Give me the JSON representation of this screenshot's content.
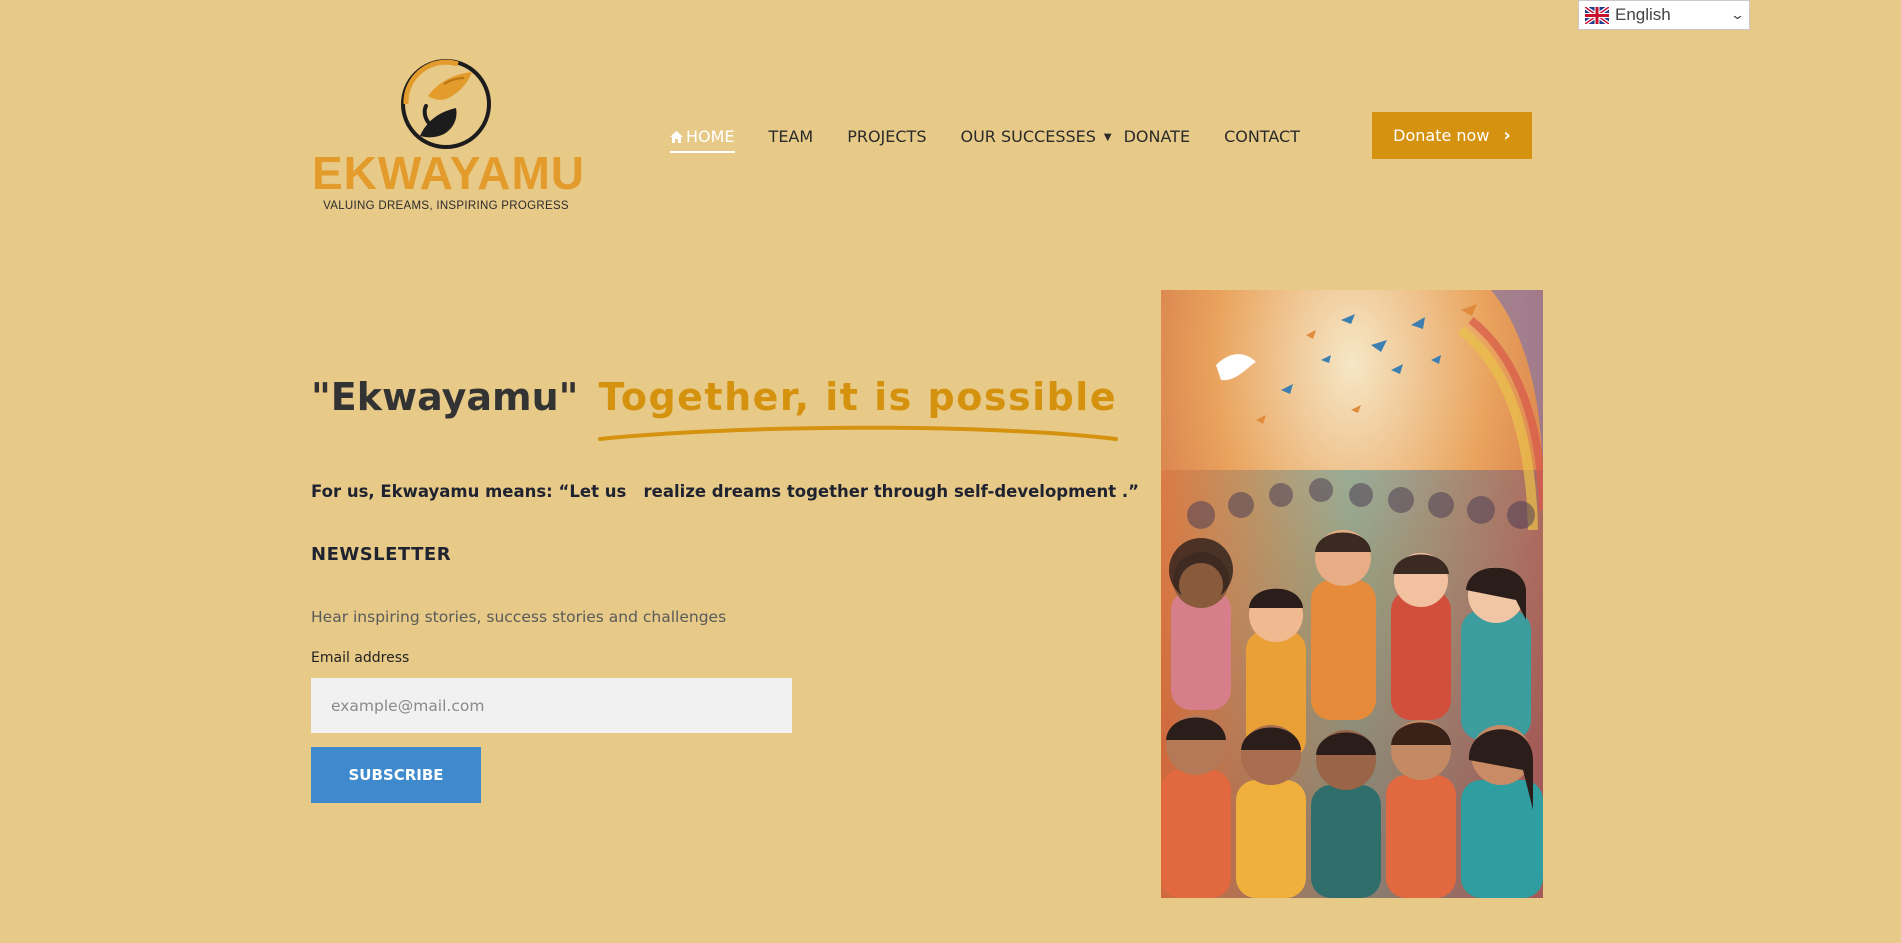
{
  "language": {
    "selected": "English",
    "flag_icon": "uk-flag-icon"
  },
  "brand": {
    "name": "EKWAYAMU",
    "tagline": "VALUING DREAMS, INSPIRING PROGRESS",
    "color": "#e39b2b"
  },
  "nav": {
    "items": [
      {
        "label": "HOME",
        "active": true,
        "icon": "home-icon"
      },
      {
        "label": "TEAM"
      },
      {
        "label": "PROJECTS"
      },
      {
        "label": "OUR SUCCESSES",
        "has_dropdown": true
      },
      {
        "label": "DONATE"
      },
      {
        "label": "CONTACT"
      }
    ],
    "cta": {
      "label": "Donate now",
      "color": "#d4920f"
    }
  },
  "hero": {
    "quote_word": "\"Ekwayamu\"",
    "tagline": "Together, it is possible",
    "meaning_prefix": "For us, Ekwayamu means: “Let us   realize dreams together through ",
    "meaning_bold": "self-development .”"
  },
  "newsletter": {
    "title": "NEWSLETTER",
    "description": "Hear inspiring stories, success stories and challenges",
    "email_label": "Email address",
    "email_placeholder": "example@mail.com",
    "email_value": "",
    "subscribe_label": "SUBSCRIBE",
    "subscribe_color": "#3f8acc"
  },
  "colors": {
    "background": "#e8ca88",
    "accent": "#d4920f"
  }
}
